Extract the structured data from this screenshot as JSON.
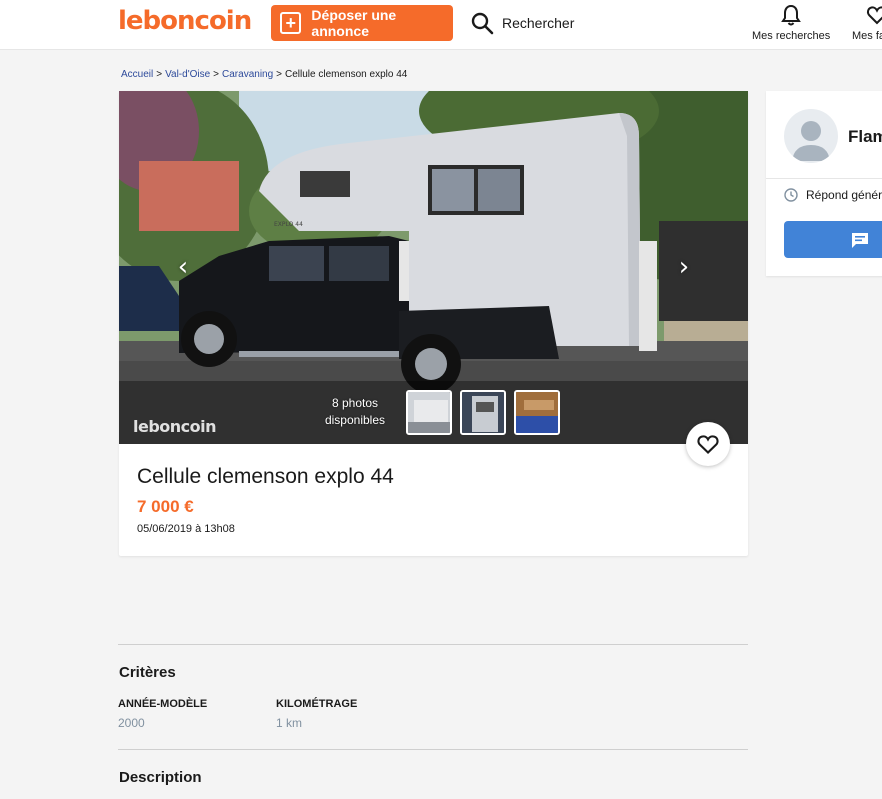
{
  "header": {
    "logo": "leboncoin",
    "deposit_label": "Déposer une annonce",
    "search_label": "Rechercher",
    "nav": {
      "searches_label": "Mes recherches",
      "favorites_label": "Mes favoris"
    }
  },
  "breadcrumb": {
    "items": [
      "Accueil",
      "Val-d'Oise",
      "Caravaning"
    ],
    "current": "Cellule clemenson explo 44"
  },
  "ad": {
    "title": "Cellule clemenson explo 44",
    "price": "7 000 €",
    "date": "05/06/2019 à 13h08",
    "photo_count_line1": "8 photos",
    "photo_count_line2": "disponibles",
    "watermark": "leboncoin",
    "camper_label": "EXPLO 44"
  },
  "seller": {
    "name": "Flamand",
    "responds": "Répond généralement"
  },
  "criteria": {
    "title": "Critères",
    "items": [
      {
        "label": "ANNÉE-MODÈLE",
        "value": "2000"
      },
      {
        "label": "KILOMÉTRAGE",
        "value": "1 km"
      }
    ]
  },
  "description": {
    "title": "Description"
  },
  "colors": {
    "brand": "#f56b2a",
    "link": "#2d4a9b",
    "message_button": "#4183d7"
  }
}
